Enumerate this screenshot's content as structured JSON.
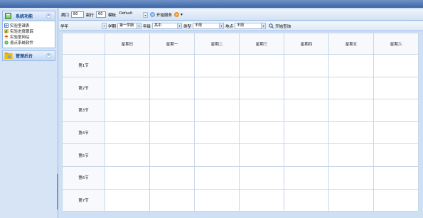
{
  "window": {
    "title": ""
  },
  "sidebar": {
    "panels": [
      {
        "title": "系统功能",
        "icon": "book-icon",
        "expanded": true,
        "items": [
          {
            "label": "实验室课表",
            "icon": "table-icon"
          },
          {
            "label": "实验进度跟踪",
            "icon": "chart-icon"
          },
          {
            "label": "实验室网站",
            "icon": "home-icon"
          },
          {
            "label": "易点系统软件",
            "icon": "globe-icon"
          }
        ]
      },
      {
        "title": "管理后台",
        "icon": "folder-icon",
        "expanded": false,
        "items": []
      }
    ]
  },
  "toolbar": {
    "width_label": "摘口",
    "width_value": "80",
    "height_label": "副行",
    "height_value": "60",
    "template_label": "模板",
    "template_value": "Default",
    "start_service_label": "开始服务"
  },
  "filters": {
    "xueke_label": "学年",
    "xueke_value": "",
    "term_label": "学期",
    "term_value": "第一学期",
    "grade_label": "年级",
    "grade_value": "高中",
    "type_label": "类型",
    "type_value": "不限",
    "place_label": "地点",
    "place_value": "不限",
    "query_label": "开始查询"
  },
  "schedule": {
    "days": [
      "星期日",
      "星期一",
      "星期二",
      "星期三",
      "星期四",
      "星期五",
      "星期六"
    ],
    "periods": [
      "第1节",
      "第2节",
      "第3节",
      "第4节",
      "第5节",
      "第6节",
      "第7节"
    ]
  },
  "colors": {
    "accent": "#15428b",
    "border": "#99bbe8",
    "titlebar": "#3d66a8"
  }
}
